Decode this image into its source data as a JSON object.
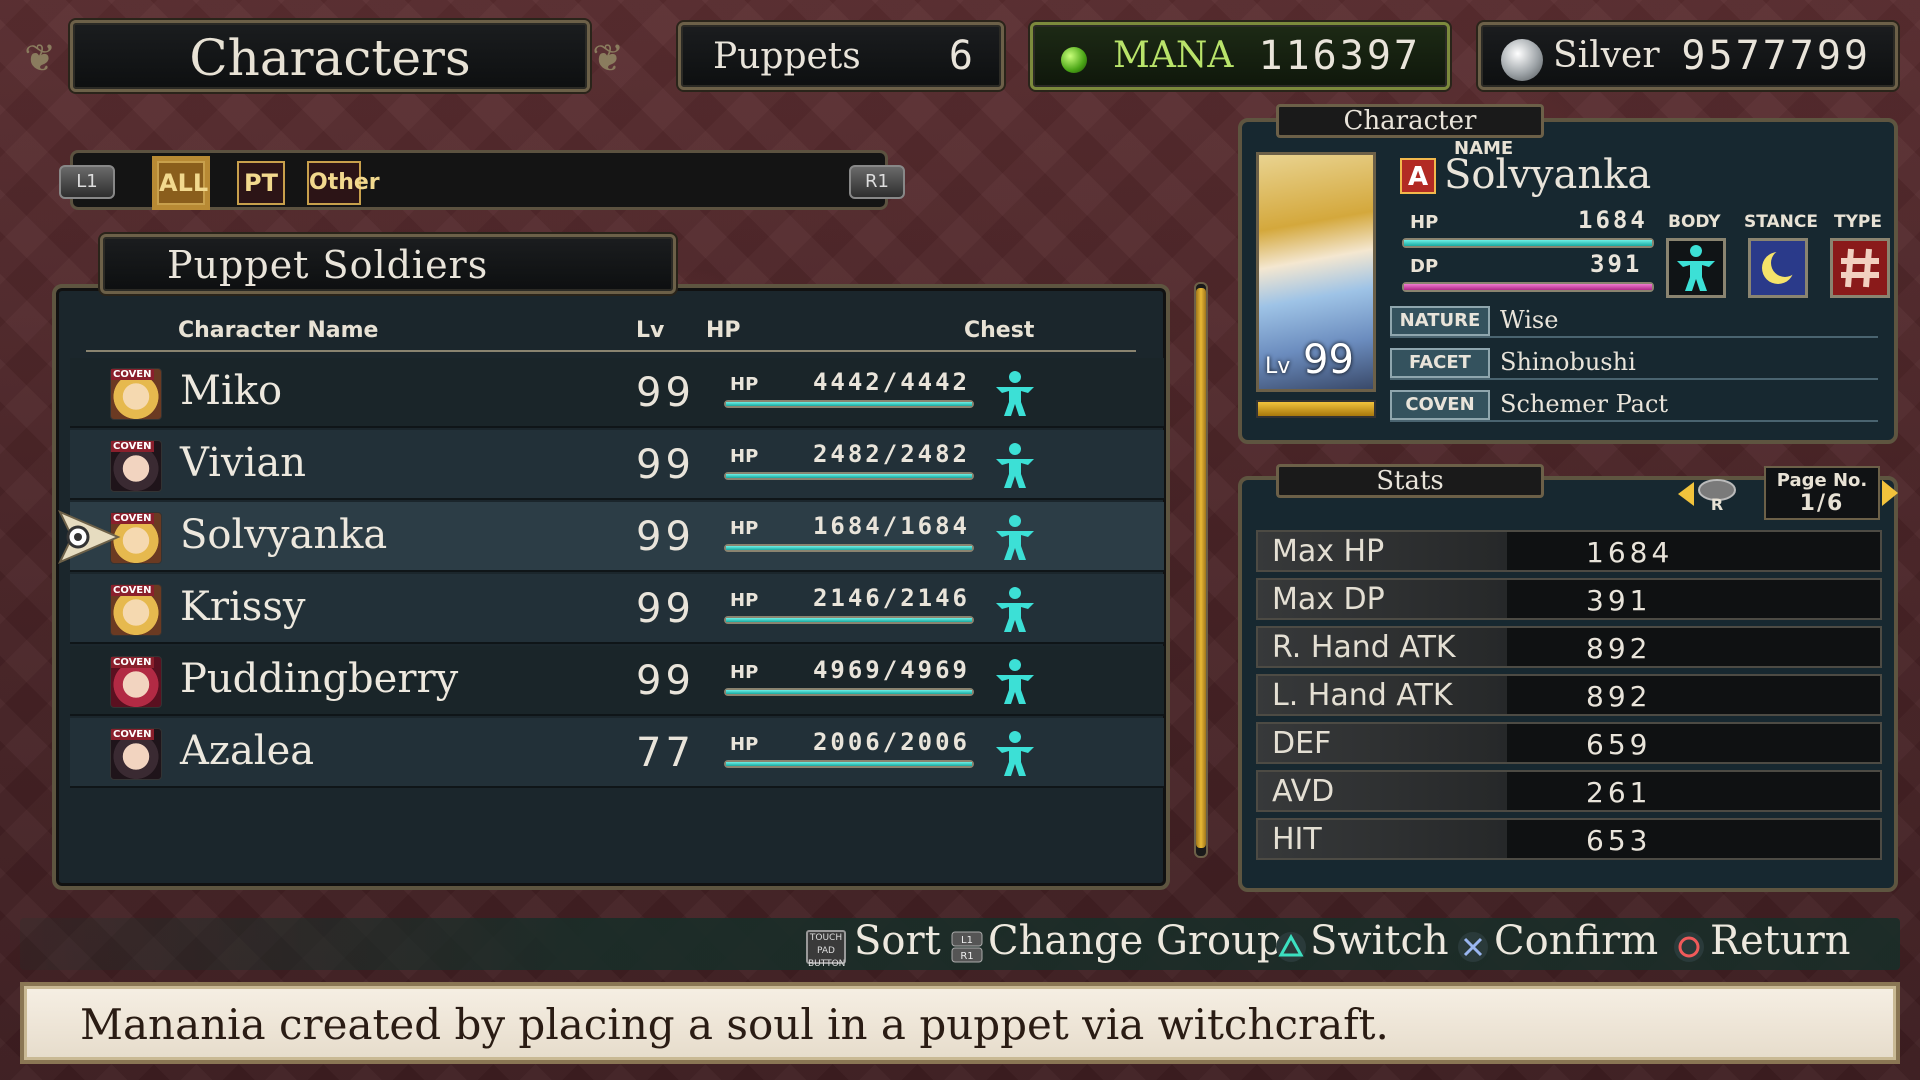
{
  "header": {
    "title": "Characters",
    "puppets_label": "Puppets",
    "puppets_value": "6",
    "mana_label": "MANA",
    "mana_value": "116397",
    "silver_label": "Silver",
    "silver_value": "9577799"
  },
  "tabs": {
    "l_button": "L1",
    "r_button": "R1",
    "items": [
      "ALL",
      "PT",
      "Other"
    ],
    "active": "ALL"
  },
  "roster": {
    "group_title": "Puppet Soldiers",
    "columns": {
      "name": "Character Name",
      "level": "Lv",
      "hp": "HP",
      "chest": "Chest"
    },
    "hp_label": "HP",
    "badge": "COVEN",
    "rows": [
      {
        "name": "Miko",
        "level": "99",
        "hp": "4442/4442",
        "hp_fraction": 1.0
      },
      {
        "name": "Vivian",
        "level": "99",
        "hp": "2482/2482",
        "hp_fraction": 1.0
      },
      {
        "name": "Solvyanka",
        "level": "99",
        "hp": "1684/1684",
        "hp_fraction": 1.0,
        "selected": true
      },
      {
        "name": "Krissy",
        "level": "99",
        "hp": "2146/2146",
        "hp_fraction": 1.0
      },
      {
        "name": "Puddingberry",
        "level": "99",
        "hp": "4969/4969",
        "hp_fraction": 1.0
      },
      {
        "name": "Azalea",
        "level": "77",
        "hp": "2006/2006",
        "hp_fraction": 1.0
      }
    ]
  },
  "character": {
    "panel_title": "Character",
    "name_label": "NAME",
    "name": "Solvyanka",
    "rank_icon": "A",
    "level_prefix": "Lv",
    "level": "99",
    "hp_label": "HP",
    "hp": "1684",
    "dp_label": "DP",
    "dp": "391",
    "body_label": "BODY",
    "stance_label": "STANCE",
    "type_label": "TYPE",
    "body_icon": "humanoid-figure-icon",
    "stance_icon": "crescent-moon-icon",
    "type_icon": "hash-sign-icon",
    "nature_label": "NATURE",
    "nature": "Wise",
    "facet_label": "FACET",
    "facet": "Shinobushi",
    "coven_label": "COVEN",
    "coven": "Schemer Pact"
  },
  "stats": {
    "panel_title": "Stats",
    "page_label": "Page No.",
    "page": "1/6",
    "page_button": "R",
    "rows": [
      {
        "label": "Max HP",
        "value": "1684"
      },
      {
        "label": "Max DP",
        "value": "391"
      },
      {
        "label": "R. Hand ATK",
        "value": "892"
      },
      {
        "label": "L. Hand ATK",
        "value": "892"
      },
      {
        "label": "DEF",
        "value": "659"
      },
      {
        "label": "AVD",
        "value": "261"
      },
      {
        "label": "HIT",
        "value": "653"
      }
    ]
  },
  "controls": {
    "touchpad_text": "TOUCH PAD BUTTON",
    "sort": "Sort",
    "change_group": "Change Group",
    "switch": "Switch",
    "confirm": "Confirm",
    "return": "Return"
  },
  "description": "Manania created by placing a soul in a puppet via witchcraft.",
  "colors": {
    "hp_bar": "#1fc2b8",
    "dp_bar": "#c23a9a",
    "mana_text": "#b9e36a",
    "tab_gold": "#c8a04c"
  }
}
